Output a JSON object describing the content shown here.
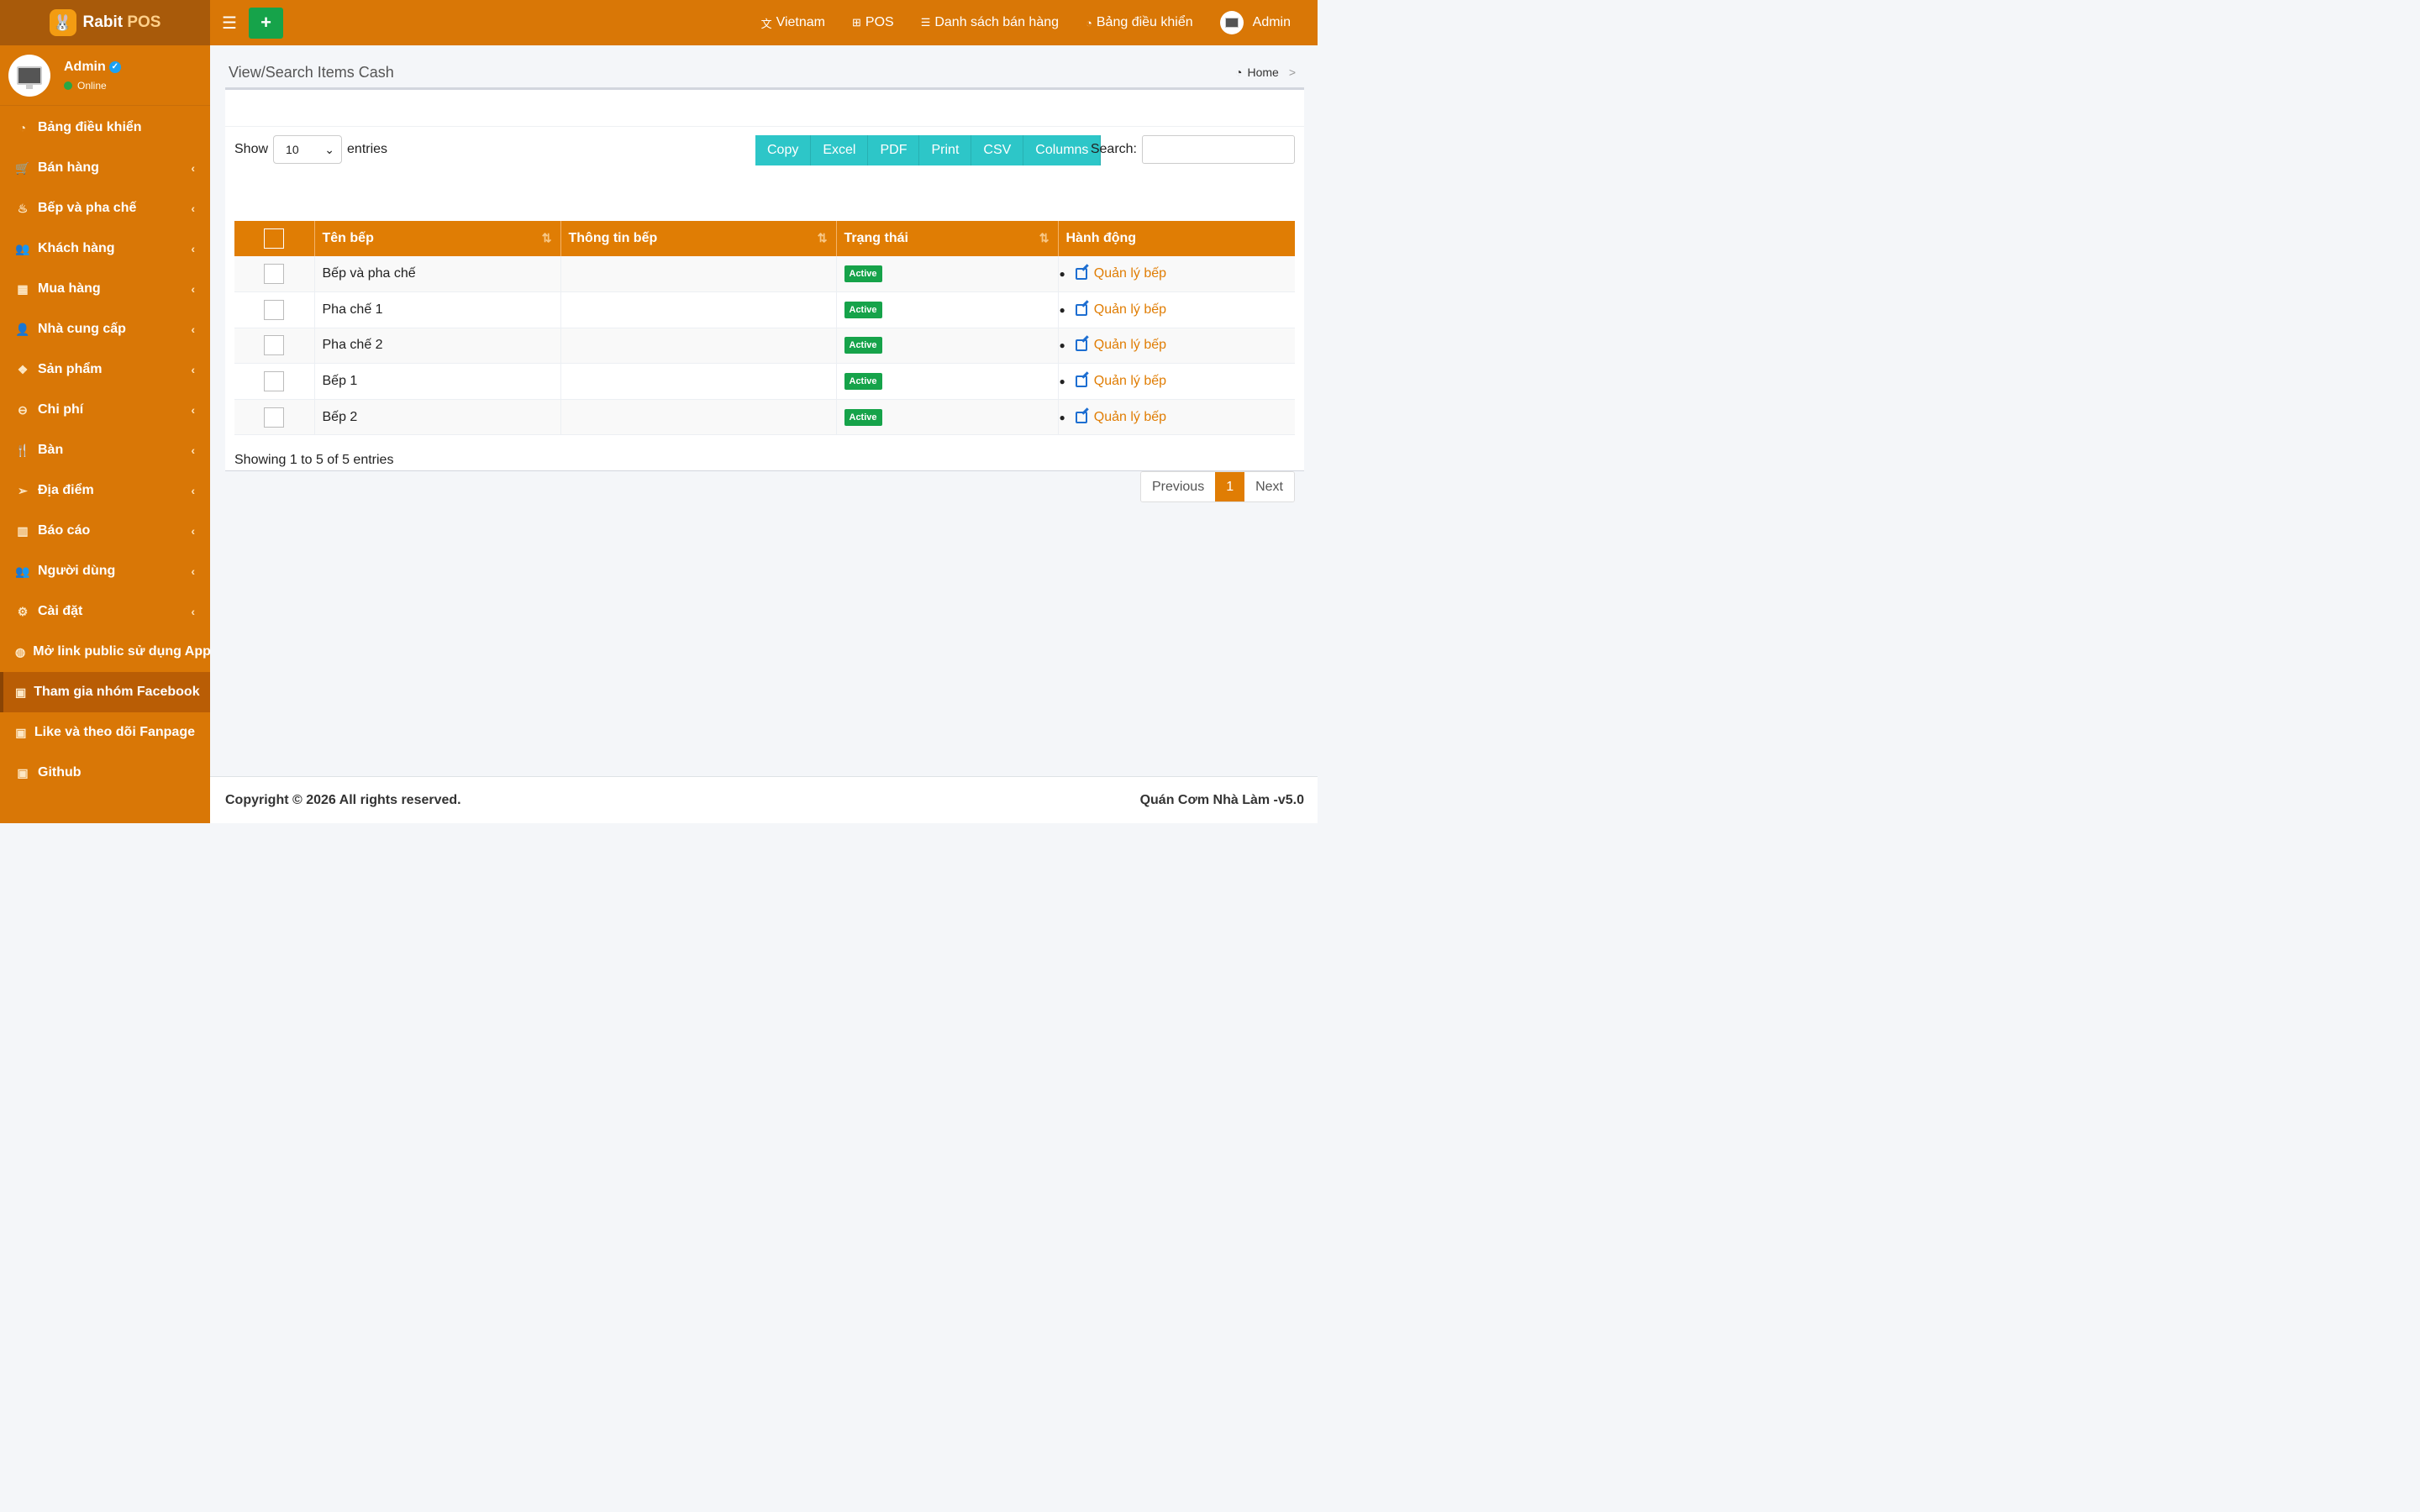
{
  "brand": {
    "name": "Rabit",
    "suffix": "POS"
  },
  "user": {
    "name": "Admin",
    "status": "Online"
  },
  "sidebar": {
    "items": [
      {
        "label": "Bảng điều khiển",
        "icon": "dashboard-icon",
        "glyph": "◔",
        "has_children": false
      },
      {
        "label": "Bán hàng",
        "icon": "cart-icon",
        "glyph": "🛒",
        "has_children": true
      },
      {
        "label": "Bếp và pha chế",
        "icon": "cook-icon",
        "glyph": "♨",
        "has_children": true
      },
      {
        "label": "Khách hàng",
        "icon": "users-icon",
        "glyph": "👥",
        "has_children": true
      },
      {
        "label": "Mua hàng",
        "icon": "grid-icon",
        "glyph": "▦",
        "has_children": true
      },
      {
        "label": "Nhà cung cấp",
        "icon": "supplier-icon",
        "glyph": "👤",
        "has_children": true
      },
      {
        "label": "Sản phẩm",
        "icon": "cubes-icon",
        "glyph": "❖",
        "has_children": true
      },
      {
        "label": "Chi phí",
        "icon": "minus-circle-icon",
        "glyph": "⊖",
        "has_children": true
      },
      {
        "label": "Bàn",
        "icon": "utensils-icon",
        "glyph": "🍴",
        "has_children": true
      },
      {
        "label": "Địa điểm",
        "icon": "paper-plane-icon",
        "glyph": "➢",
        "has_children": true
      },
      {
        "label": "Báo cáo",
        "icon": "bar-chart-icon",
        "glyph": "▥",
        "has_children": true
      },
      {
        "label": "Người dùng",
        "icon": "users-icon",
        "glyph": "👥",
        "has_children": true
      },
      {
        "label": "Cài đặt",
        "icon": "cogs-icon",
        "glyph": "⚙",
        "has_children": true
      },
      {
        "label": "Mở link public sử dụng App",
        "icon": "globe-icon",
        "glyph": "◍",
        "has_children": false
      },
      {
        "label": "Tham gia nhóm Facebook",
        "icon": "briefcase-icon",
        "glyph": "▣",
        "has_children": false,
        "active": true
      },
      {
        "label": "Like và theo dõi Fanpage",
        "icon": "briefcase-icon",
        "glyph": "▣",
        "has_children": false
      },
      {
        "label": "Github",
        "icon": "briefcase-icon",
        "glyph": "▣",
        "has_children": false
      }
    ]
  },
  "topbar": {
    "add_label": "+",
    "nav": [
      {
        "label": "Vietnam",
        "icon": "language-icon",
        "glyph": "文"
      },
      {
        "label": "POS",
        "icon": "plus-square-icon",
        "glyph": "⊞"
      },
      {
        "label": "Danh sách bán hàng",
        "icon": "list-icon",
        "glyph": "☰"
      },
      {
        "label": "Bảng điều khiển",
        "icon": "dashboard-icon",
        "glyph": "◔"
      }
    ],
    "user_label": "Admin"
  },
  "page": {
    "title": "View/Search Items Cash",
    "breadcrumb_home": "Home",
    "breadcrumb_sep": ">"
  },
  "table_controls": {
    "show_label": "Show",
    "page_size": "10",
    "entries_label": "entries",
    "buttons": [
      "Copy",
      "Excel",
      "PDF",
      "Print",
      "CSV",
      "Columns"
    ],
    "search_label": "Search:"
  },
  "table": {
    "headers": [
      "Tên bếp",
      "Thông tin bếp",
      "Trạng thái",
      "Hành động"
    ],
    "rows": [
      {
        "name": "Bếp và pha chế",
        "info": "",
        "status": "Active",
        "action": "Quản lý bếp"
      },
      {
        "name": "Pha chế 1",
        "info": "",
        "status": "Active",
        "action": "Quản lý bếp"
      },
      {
        "name": "Pha chế 2",
        "info": "",
        "status": "Active",
        "action": "Quản lý bếp"
      },
      {
        "name": "Bếp 1",
        "info": "",
        "status": "Active",
        "action": "Quản lý bếp"
      },
      {
        "name": "Bếp 2",
        "info": "",
        "status": "Active",
        "action": "Quản lý bếp"
      }
    ],
    "info_text": "Showing 1 to 5 of 5 entries",
    "pagination": {
      "previous": "Previous",
      "current": "1",
      "next": "Next"
    }
  },
  "footer": {
    "copyright": "Copyright © 2026 All rights reserved.",
    "version": "Quán Cơm Nhà Làm -v5.0"
  },
  "colors": {
    "primary": "#d97706",
    "accent": "#e07d04",
    "teal": "#2dc6c8",
    "success": "#16a34a"
  }
}
